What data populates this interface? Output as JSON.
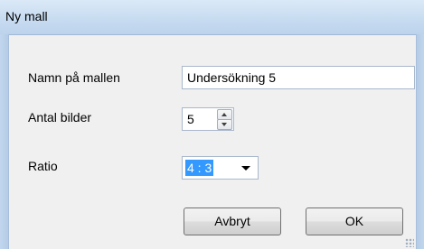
{
  "window": {
    "title": "Ny mall"
  },
  "form": {
    "name_label": "Namn på mallen",
    "name_value": "Undersökning 5",
    "count_label": "Antal bilder",
    "count_value": "5",
    "ratio_label": "Ratio",
    "ratio_value": "4 : 3"
  },
  "buttons": {
    "cancel": "Avbryt",
    "ok": "OK"
  }
}
